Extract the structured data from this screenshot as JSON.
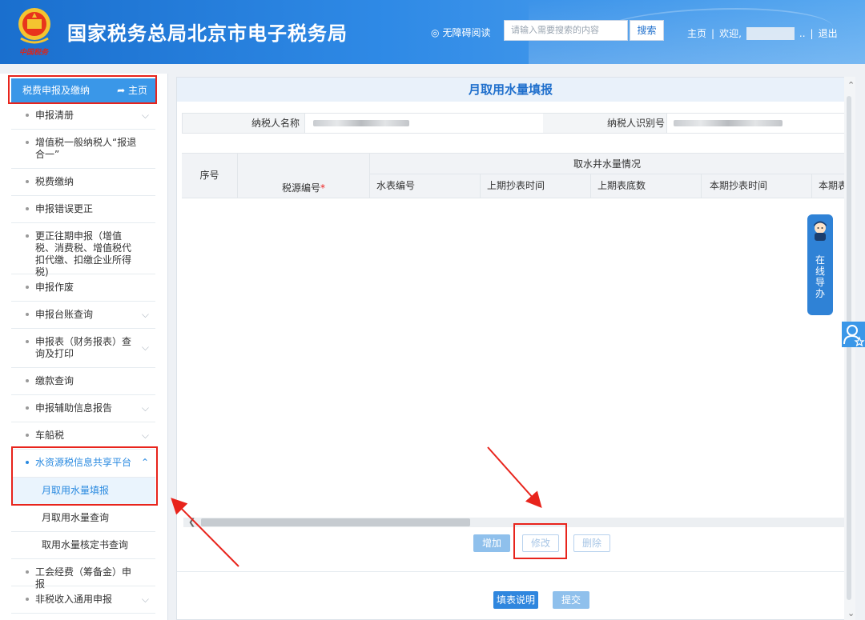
{
  "header": {
    "site_title": "国家税务总局北京市电子税务局",
    "emblem_motto": "中国税务",
    "accessible_label": "无障碍阅读",
    "search_placeholder": "请输入需要搜索的内容",
    "search_button": "搜索",
    "home_link": "主页",
    "separator": "|",
    "welcome_label": "欢迎,",
    "user_suffix": "..",
    "logout_link": "退出"
  },
  "sidebar": {
    "head_label": "税费申报及缴纳",
    "head_home": "主页",
    "items": [
      {
        "label": "申报清册",
        "chevron": "⌵"
      },
      {
        "label": "增值税一般纳税人“报退合一”",
        "chevron": ""
      },
      {
        "label": "税费缴纳",
        "chevron": ""
      },
      {
        "label": "申报错误更正",
        "chevron": ""
      },
      {
        "label": "更正往期申报（增值税、消费税、增值税代扣代缴、扣缴企业所得税)",
        "chevron": ""
      },
      {
        "label": "申报作废",
        "chevron": ""
      },
      {
        "label": "申报台账查询",
        "chevron": "⌵"
      },
      {
        "label": "申报表（财务报表）查询及打印",
        "chevron": "⌵"
      },
      {
        "label": "缴款查询",
        "chevron": ""
      },
      {
        "label": "申报辅助信息报告",
        "chevron": "⌵"
      },
      {
        "label": "车船税",
        "chevron": "⌵"
      },
      {
        "label": "水资源税信息共享平台",
        "chevron": "⌃"
      },
      {
        "label": "月取用水量填报",
        "chevron": ""
      },
      {
        "label": "月取用水量查询",
        "chevron": ""
      },
      {
        "label": "取用水量核定书查询",
        "chevron": ""
      },
      {
        "label": "工会经费（筹备金）申报",
        "chevron": ""
      },
      {
        "label": "非税收入通用申报",
        "chevron": "⌵"
      }
    ]
  },
  "form": {
    "title": "月取用水量填报",
    "taxpayer_name_label": "纳税人名称",
    "taxpayer_id_label": "纳税人识别号",
    "table": {
      "col_seq": "序号",
      "col_source": "税源编号",
      "required_mark": "*",
      "group_header": "取水井水量情况",
      "sub_headers": [
        "水表编号",
        "上期抄表时间",
        "上期表底数",
        "本期抄表时间",
        "本期表"
      ]
    },
    "buttons": {
      "add": "增加",
      "modify": "修改",
      "delete": "删除",
      "instructions": "填表说明",
      "submit": "提交"
    }
  },
  "floating": {
    "guide_text": [
      "在",
      "线",
      "导",
      "办"
    ]
  }
}
